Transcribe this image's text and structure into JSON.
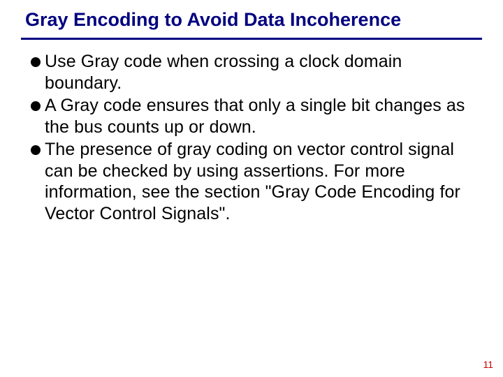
{
  "title": "Gray Encoding to Avoid Data Incoherence",
  "bullets": [
    "Use Gray code when crossing a clock domain boundary.",
    "A Gray code ensures that only a single bit changes as the bus counts up or down.",
    "The presence of gray coding on vector control signal can be checked by using assertions. For more information, see the section \"Gray Code Encoding for Vector Control Signals\"."
  ],
  "page_number": "11"
}
